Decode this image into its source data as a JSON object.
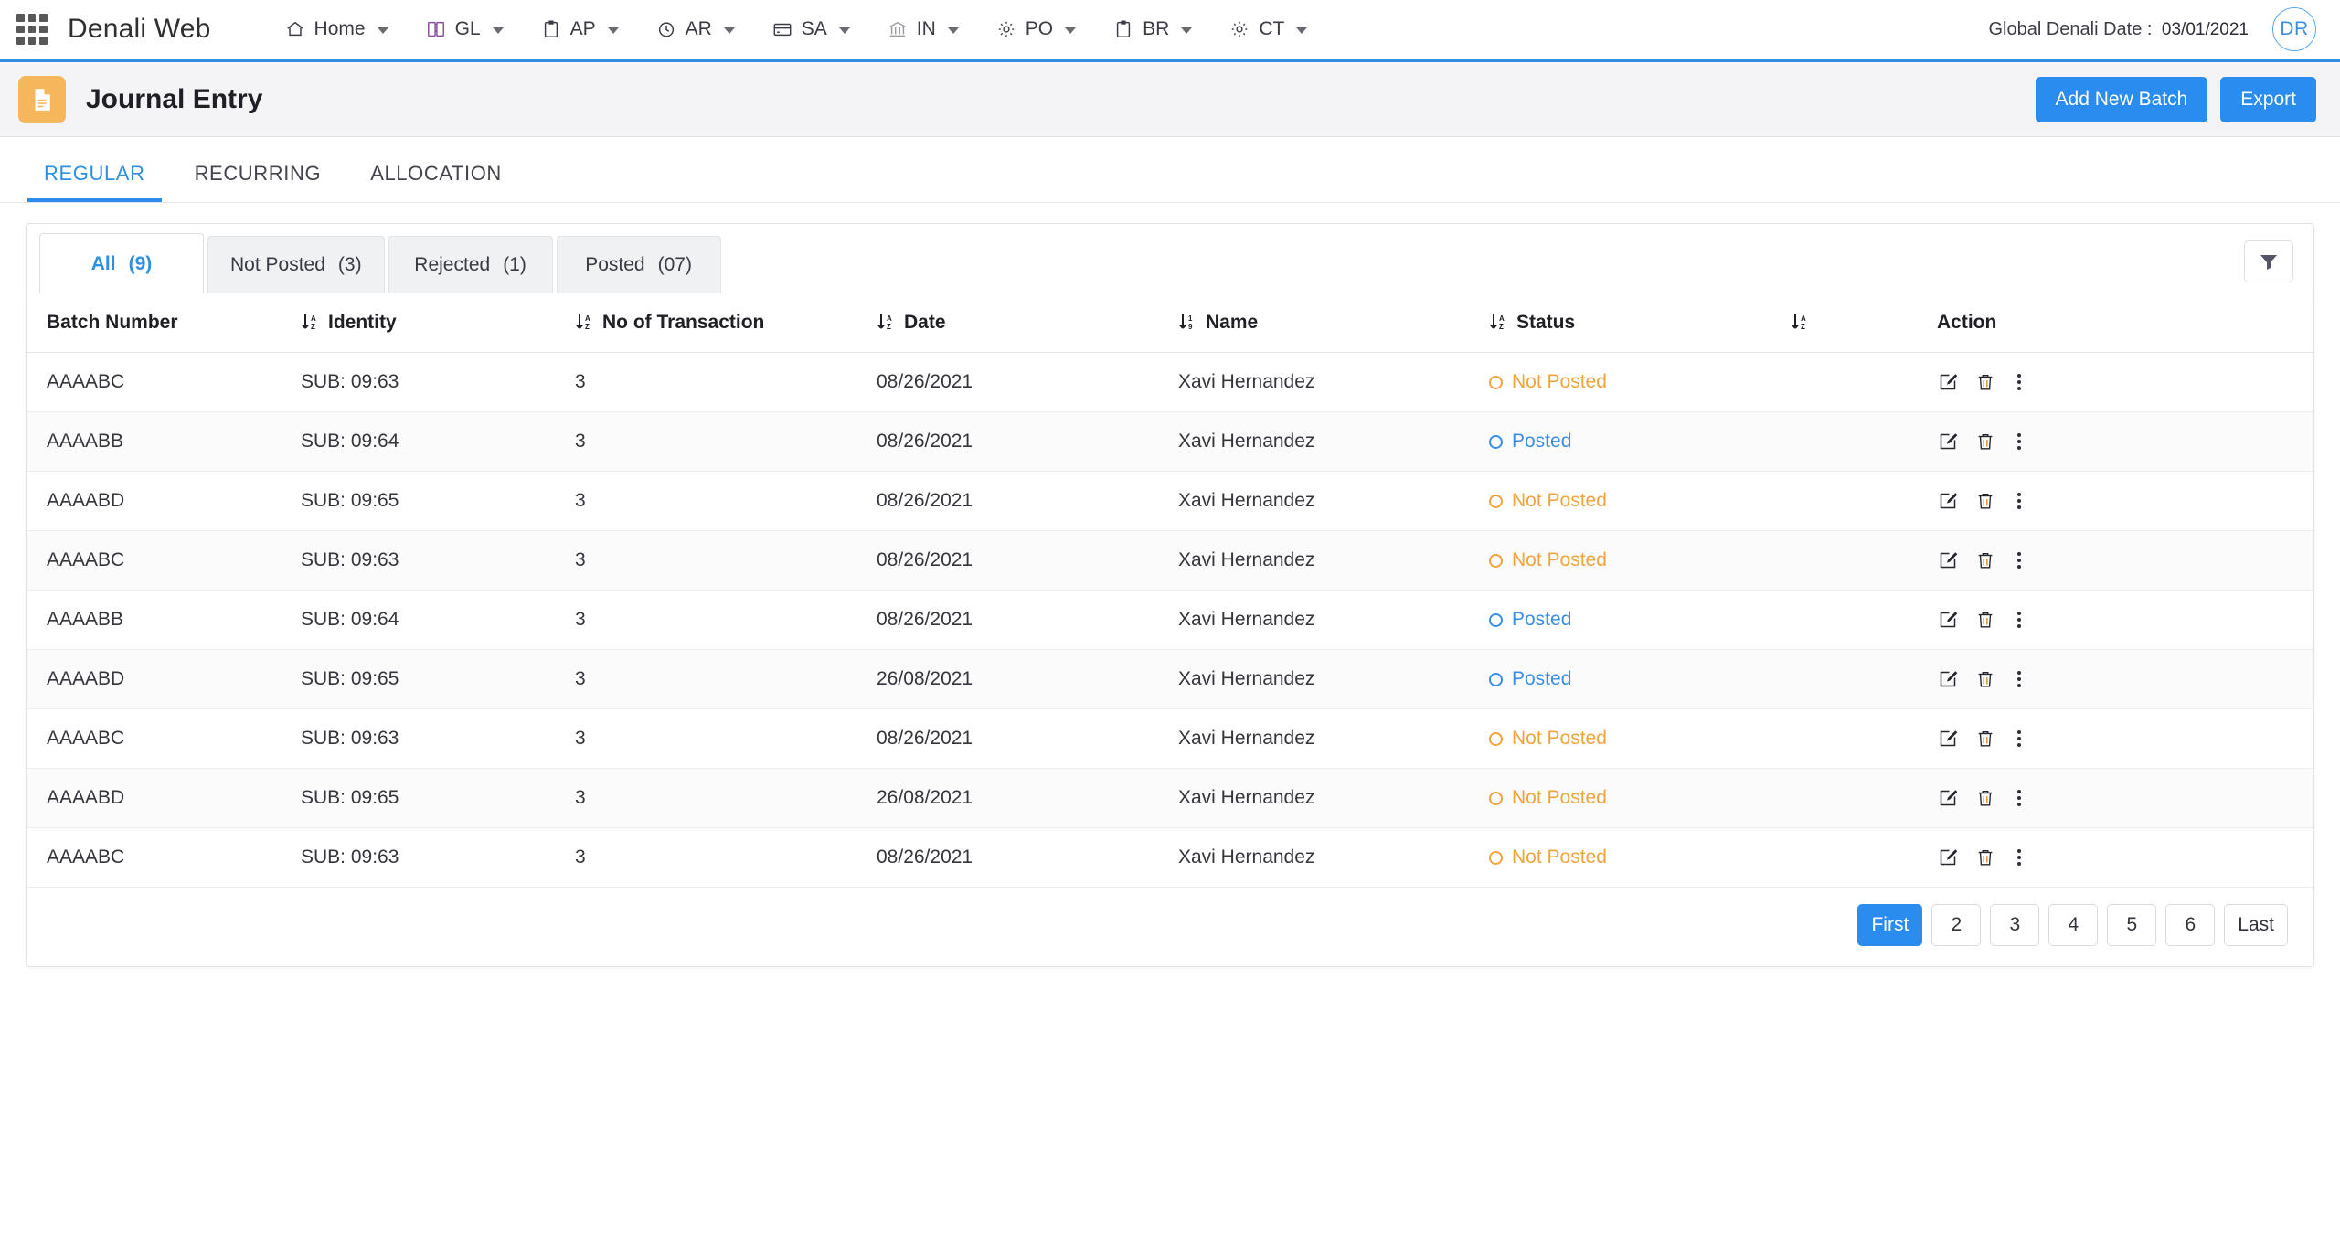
{
  "topbar": {
    "app_grid_icon": "apps-grid-icon",
    "brand": "Denali Web",
    "nav": [
      {
        "label": "Home",
        "icon": "home-icon"
      },
      {
        "label": "GL",
        "icon": "book-icon"
      },
      {
        "label": "AP",
        "icon": "clipboard-icon"
      },
      {
        "label": "AR",
        "icon": "clock-icon"
      },
      {
        "label": "SA",
        "icon": "card-icon"
      },
      {
        "label": "IN",
        "icon": "bank-icon"
      },
      {
        "label": "PO",
        "icon": "gear-icon"
      },
      {
        "label": "BR",
        "icon": "clipboard-icon"
      },
      {
        "label": "CT",
        "icon": "gear-icon"
      }
    ],
    "global_date_label": "Global Denali Date :",
    "global_date_value": "03/01/2021",
    "avatar_initials": "DR"
  },
  "page_header": {
    "icon": "document-icon",
    "title": "Journal Entry",
    "add_button": "Add New Batch",
    "export_button": "Export"
  },
  "main_tabs": [
    {
      "label": "REGULAR",
      "active": true
    },
    {
      "label": "RECURRING",
      "active": false
    },
    {
      "label": "ALLOCATION",
      "active": false
    }
  ],
  "sub_tabs": [
    {
      "label": "All",
      "count": "(9)",
      "active": true
    },
    {
      "label": "Not Posted",
      "count": "(3)",
      "active": false
    },
    {
      "label": "Rejected",
      "count": "(1)",
      "active": false
    },
    {
      "label": "Posted",
      "count": "(07)",
      "active": false
    }
  ],
  "filter_icon": "filter-icon",
  "table": {
    "columns": [
      {
        "label": "Batch Number",
        "sort": null
      },
      {
        "label": "Identity",
        "sort": "az"
      },
      {
        "label": "No of Transaction",
        "sort": "az"
      },
      {
        "label": "Date",
        "sort": "az"
      },
      {
        "label": "Name",
        "sort": "19"
      },
      {
        "label": "Status",
        "sort": "az"
      },
      {
        "label": "",
        "sort": "az"
      },
      {
        "label": "Action",
        "sort": null
      }
    ],
    "rows": [
      {
        "batch": "AAAABC",
        "identity": "SUB: 09:63",
        "txn": "3",
        "date": "08/26/2021",
        "name": "Xavi Hernandez",
        "status": "Not Posted",
        "status_kind": "notposted"
      },
      {
        "batch": "AAAABB",
        "identity": "SUB: 09:64",
        "txn": "3",
        "date": "08/26/2021",
        "name": "Xavi Hernandez",
        "status": "Posted",
        "status_kind": "posted"
      },
      {
        "batch": "AAAABD",
        "identity": "SUB: 09:65",
        "txn": "3",
        "date": "08/26/2021",
        "name": "Xavi Hernandez",
        "status": "Not Posted",
        "status_kind": "notposted"
      },
      {
        "batch": "AAAABC",
        "identity": "SUB: 09:63",
        "txn": "3",
        "date": "08/26/2021",
        "name": "Xavi Hernandez",
        "status": "Not Posted",
        "status_kind": "notposted"
      },
      {
        "batch": "AAAABB",
        "identity": "SUB: 09:64",
        "txn": "3",
        "date": "08/26/2021",
        "name": "Xavi Hernandez",
        "status": "Posted",
        "status_kind": "posted"
      },
      {
        "batch": "AAAABD",
        "identity": "SUB: 09:65",
        "txn": "3",
        "date": "26/08/2021",
        "name": "Xavi Hernandez",
        "status": "Posted",
        "status_kind": "posted"
      },
      {
        "batch": "AAAABC",
        "identity": "SUB: 09:63",
        "txn": "3",
        "date": "08/26/2021",
        "name": "Xavi Hernandez",
        "status": "Not Posted",
        "status_kind": "notposted"
      },
      {
        "batch": "AAAABD",
        "identity": "SUB: 09:65",
        "txn": "3",
        "date": "26/08/2021",
        "name": "Xavi Hernandez",
        "status": "Not Posted",
        "status_kind": "notposted"
      },
      {
        "batch": "AAAABC",
        "identity": "SUB: 09:63",
        "txn": "3",
        "date": "08/26/2021",
        "name": "Xavi Hernandez",
        "status": "Not Posted",
        "status_kind": "notposted"
      }
    ],
    "row_actions": [
      {
        "icon": "edit-icon"
      },
      {
        "icon": "trash-icon"
      },
      {
        "icon": "more-vertical-icon"
      }
    ]
  },
  "pagination": [
    {
      "label": "First",
      "active": true
    },
    {
      "label": "2",
      "active": false
    },
    {
      "label": "3",
      "active": false
    },
    {
      "label": "4",
      "active": false
    },
    {
      "label": "5",
      "active": false
    },
    {
      "label": "6",
      "active": false
    },
    {
      "label": "Last",
      "active": false
    }
  ],
  "colors": {
    "accent_blue": "#2b8cf0",
    "status_not_posted": "#f0a43c",
    "status_posted": "#3b8fe0",
    "page_icon_bg": "#f6b65c"
  }
}
